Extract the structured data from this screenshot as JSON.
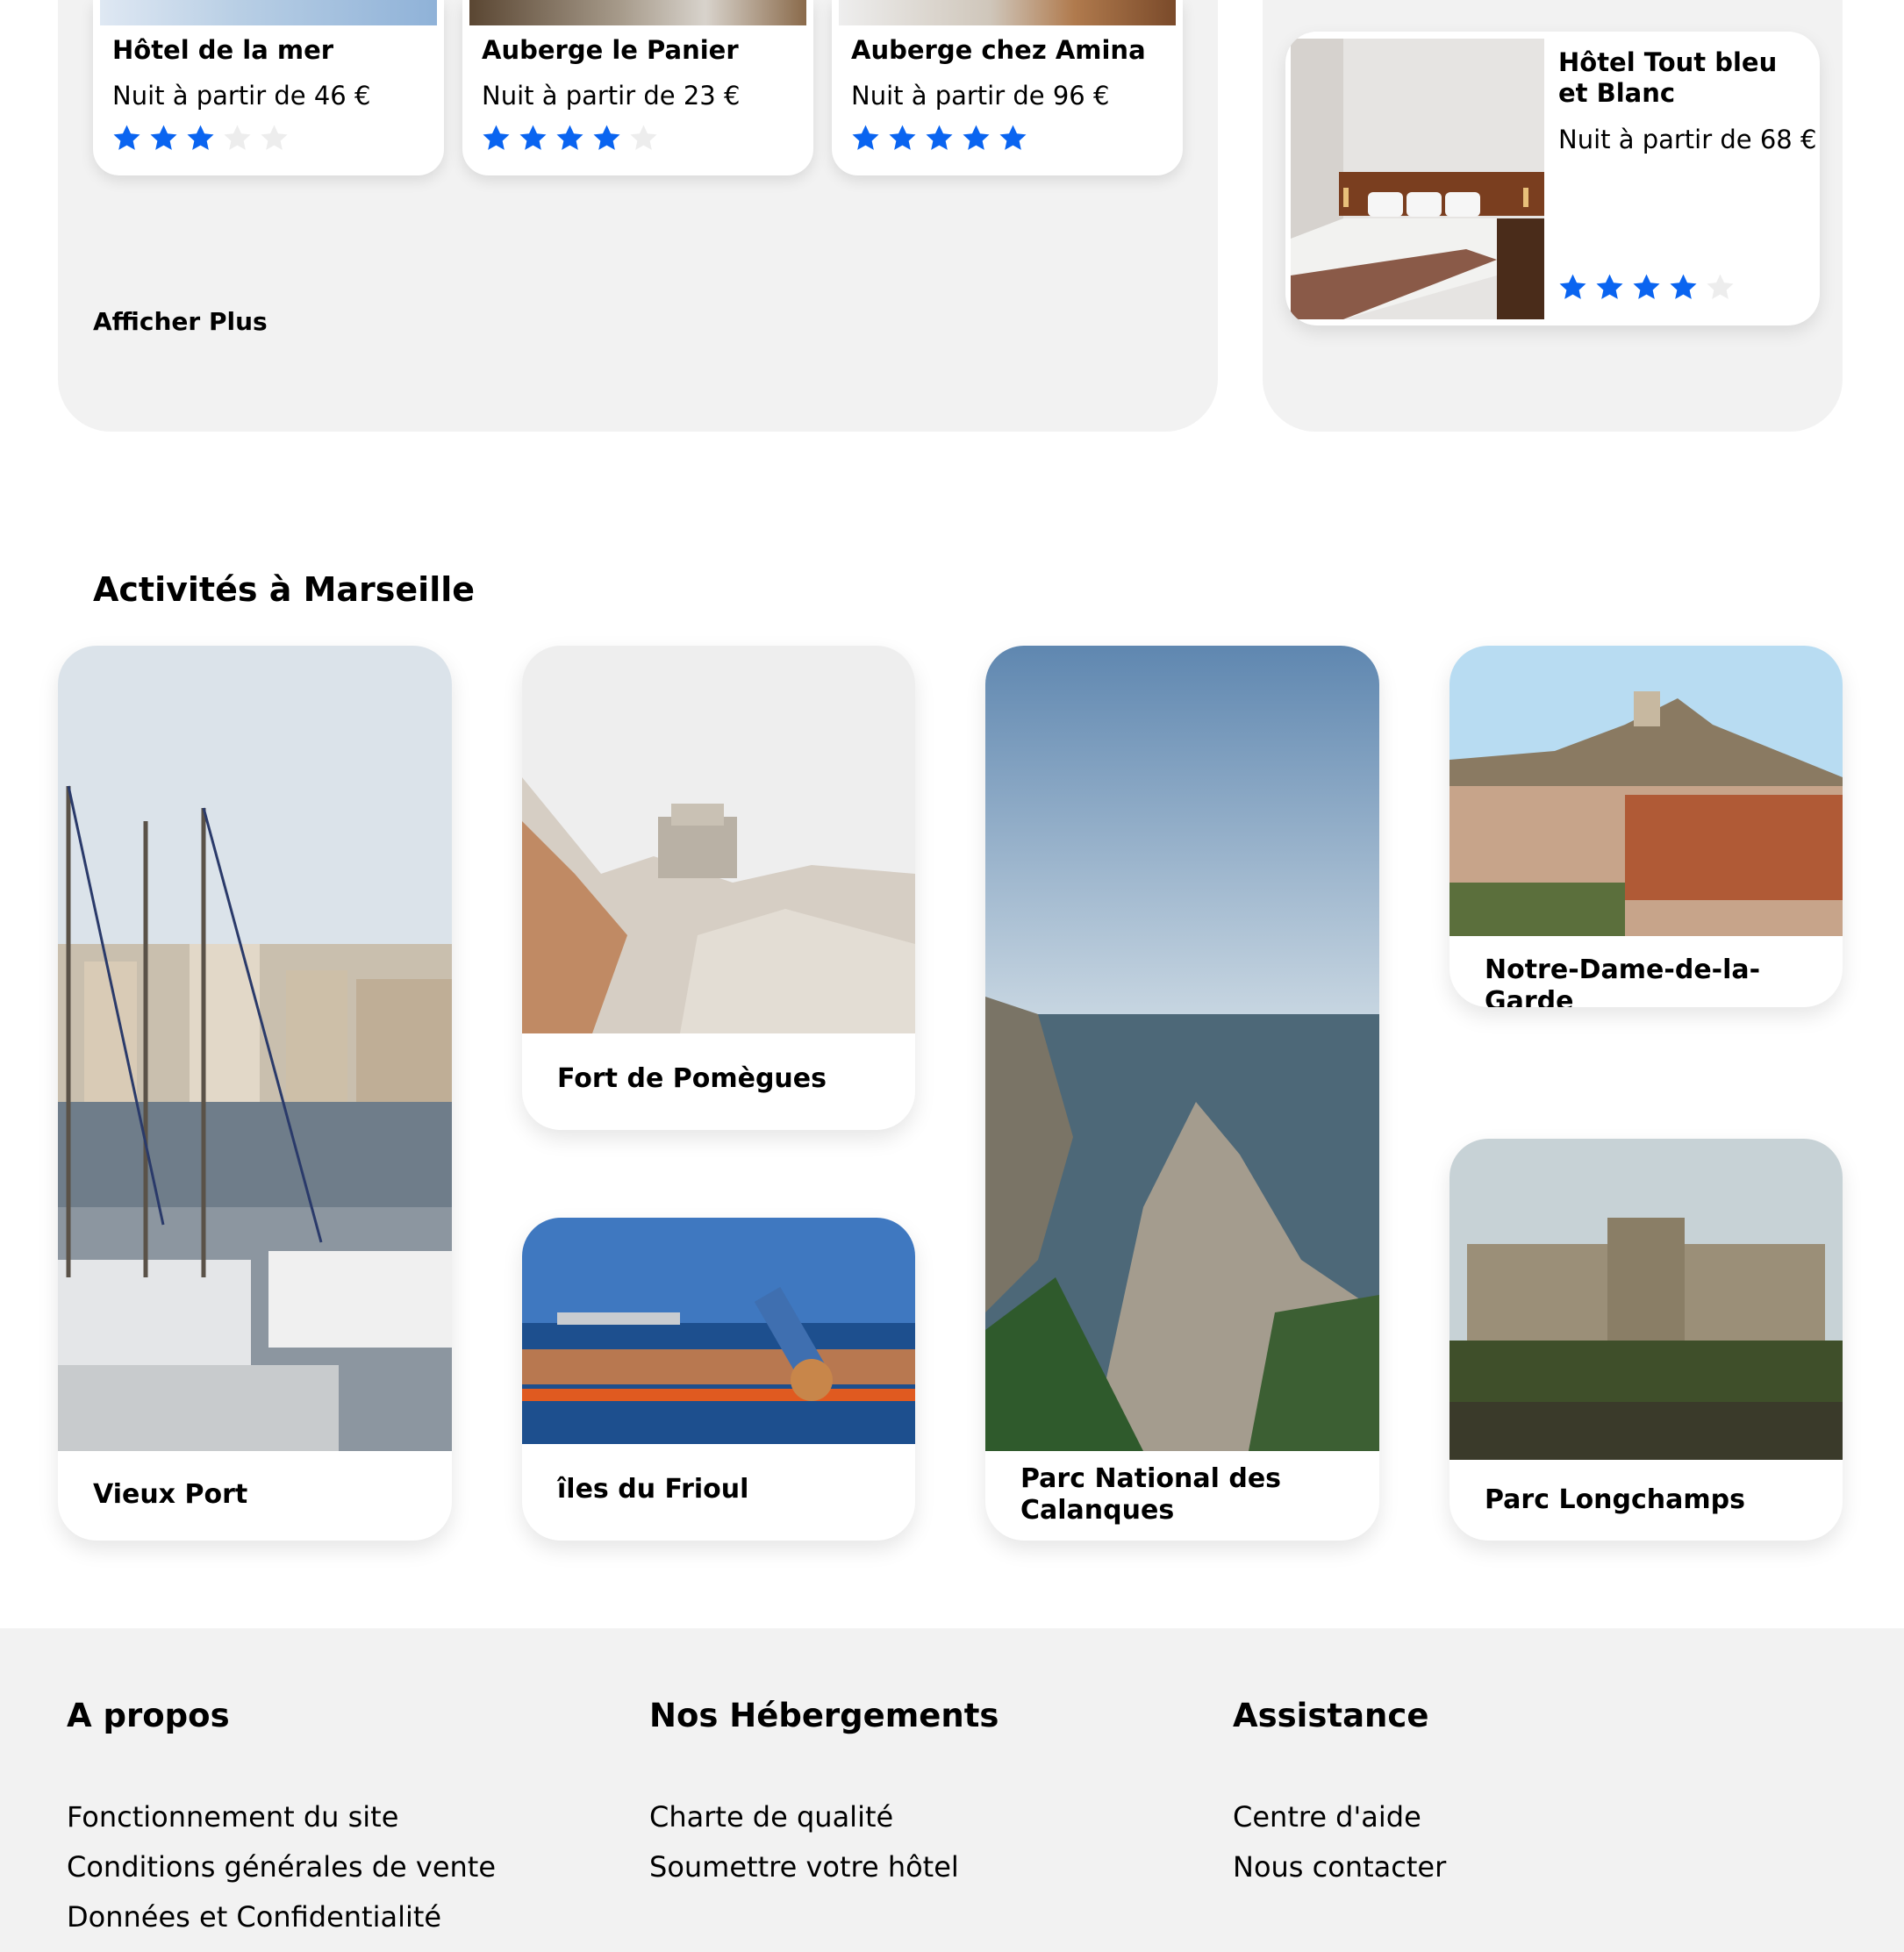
{
  "hotels": [
    {
      "name": "Hôtel de la mer",
      "price": "Nuit à partir de 46 €",
      "rating": 3
    },
    {
      "name": "Auberge le Panier",
      "price": "Nuit à partir de 23 €",
      "rating": 4
    },
    {
      "name": "Auberge chez Amina",
      "price": "Nuit à partir de 96 €",
      "rating": 5
    }
  ],
  "featured_hotel": {
    "name": "Hôtel Tout bleu et Blanc",
    "price": "Nuit à partir de 68 €",
    "rating": 4
  },
  "show_more_label": "Afficher Plus",
  "activities_title": "Activités à Marseille",
  "activities": [
    {
      "name": "Vieux Port"
    },
    {
      "name": "Fort de Pomègues"
    },
    {
      "name": "îles du Frioul"
    },
    {
      "name": "Parc National des Calanques"
    },
    {
      "name": "Notre-Dame-de-la-Garde"
    },
    {
      "name": "Parc Longchamps"
    }
  ],
  "footer": {
    "about": {
      "title": "A propos",
      "links": [
        "Fonctionnement du site",
        "Conditions générales de vente",
        "Données et Confidentialité"
      ]
    },
    "accommodations": {
      "title": "Nos Hébergements",
      "links": [
        "Charte de qualité",
        "Soumettre votre hôtel"
      ]
    },
    "support": {
      "title": "Assistance",
      "links": [
        "Centre d'aide",
        "Nous contacter"
      ]
    }
  },
  "colors": {
    "star_filled": "#0a64f0",
    "star_empty": "#ededed",
    "panel": "#f2f2f2"
  }
}
